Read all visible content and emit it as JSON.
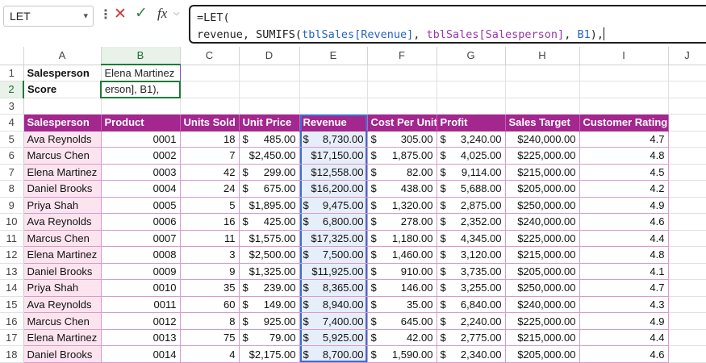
{
  "namebox": {
    "value": "LET"
  },
  "formula": {
    "line1": "=LET(",
    "line2": {
      "var": "revenue, ",
      "fn": "SUMIFS(",
      "ref1": "tblSales[Revenue]",
      "sep1": ", ",
      "ref2": "tblSales[Salesperson]",
      "sep2": ", ",
      "ref3": "B1",
      "end": "),"
    }
  },
  "icons": {
    "cancel": "x-icon",
    "enter": "check-icon",
    "function": "fx-icon"
  },
  "columns": [
    "A",
    "B",
    "C",
    "D",
    "E",
    "F",
    "G",
    "H",
    "I",
    "J"
  ],
  "row_numbers": [
    "1",
    "2",
    "3",
    "4",
    "5",
    "6",
    "7",
    "8",
    "9",
    "10",
    "11",
    "12",
    "13",
    "14",
    "15",
    "16",
    "17",
    "18"
  ],
  "inputs": {
    "salesperson_label": "Salesperson",
    "salesperson_value": "Elena Martinez",
    "score_label": "Score",
    "score_value": "erson], B1),"
  },
  "table": {
    "headers": [
      "Salesperson",
      "Product",
      "Units Sold",
      "Unit Price",
      "Revenue",
      "Cost Per Unit",
      "Profit",
      "Sales Target",
      "Customer Rating"
    ],
    "rows": [
      [
        "Ava Reynolds",
        "0001",
        "18",
        "485.00",
        "8,730.00",
        "305.00",
        "3,240.00",
        "$240,000.00",
        "4.7"
      ],
      [
        "Marcus Chen",
        "0002",
        "7",
        "$2,450.00",
        "$17,150.00",
        "1,875.00",
        "4,025.00",
        "$225,000.00",
        "4.8"
      ],
      [
        "Elena Martinez",
        "0003",
        "42",
        "299.00",
        "$12,558.00",
        "82.00",
        "9,114.00",
        "$215,000.00",
        "4.5"
      ],
      [
        "Daniel Brooks",
        "0004",
        "24",
        "675.00",
        "$16,200.00",
        "438.00",
        "5,688.00",
        "$205,000.00",
        "4.2"
      ],
      [
        "Priya Shah",
        "0005",
        "5",
        "$1,895.00",
        "9,475.00",
        "1,320.00",
        "2,875.00",
        "$250,000.00",
        "4.9"
      ],
      [
        "Ava Reynolds",
        "0006",
        "16",
        "425.00",
        "6,800.00",
        "278.00",
        "2,352.00",
        "$240,000.00",
        "4.6"
      ],
      [
        "Marcus Chen",
        "0007",
        "11",
        "$1,575.00",
        "$17,325.00",
        "1,180.00",
        "4,345.00",
        "$225,000.00",
        "4.4"
      ],
      [
        "Elena Martinez",
        "0008",
        "3",
        "$2,500.00",
        "7,500.00",
        "1,460.00",
        "3,120.00",
        "$215,000.00",
        "4.8"
      ],
      [
        "Daniel Brooks",
        "0009",
        "9",
        "$1,325.00",
        "$11,925.00",
        "910.00",
        "3,735.00",
        "$205,000.00",
        "4.1"
      ],
      [
        "Priya Shah",
        "0010",
        "35",
        "239.00",
        "8,365.00",
        "146.00",
        "3,255.00",
        "$250,000.00",
        "4.7"
      ],
      [
        "Ava Reynolds",
        "0011",
        "60",
        "149.00",
        "8,940.00",
        "35.00",
        "6,840.00",
        "$240,000.00",
        "4.3"
      ],
      [
        "Marcus Chen",
        "0012",
        "8",
        "925.00",
        "7,400.00",
        "645.00",
        "2,240.00",
        "$225,000.00",
        "4.9"
      ],
      [
        "Elena Martinez",
        "0013",
        "75",
        "79.00",
        "5,925.00",
        "42.00",
        "2,775.00",
        "$215,000.00",
        "4.4"
      ],
      [
        "Daniel Brooks",
        "0014",
        "4",
        "$2,175.00",
        "8,700.00",
        "1,590.00",
        "2,340.00",
        "$205,000.00",
        "4.6"
      ]
    ]
  },
  "colors": {
    "header_fill": "#a4268f",
    "salesperson_fill": "#fce4ef",
    "revenue_highlight": "#3b6fd4",
    "active_cell": "#1e7b3a"
  }
}
